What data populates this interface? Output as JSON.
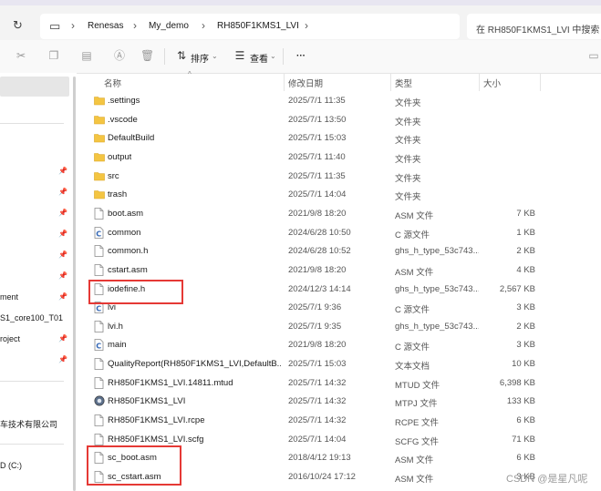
{
  "address_bar": {
    "breadcrumbs": [
      "Renesas",
      "My_demo",
      "RH850F1KMS1_LVI"
    ],
    "search_placeholder": "在 RH850F1KMS1_LVI 中搜索"
  },
  "toolbar": {
    "sort_label": "排序",
    "view_label": "查看",
    "more_label": "···"
  },
  "sidebar": {
    "items": [
      {
        "label": "ment"
      },
      {
        "label": "S1_core100_T01"
      },
      {
        "label": "roject"
      },
      {
        "label": "车技术有限公司"
      },
      {
        "label": "D (C:)"
      }
    ]
  },
  "columns": {
    "name": "名称",
    "date": "修改日期",
    "type": "类型",
    "size": "大小"
  },
  "files": [
    {
      "icon": "folder-icon",
      "name": ".settings",
      "date": "2025/7/1 11:35",
      "type": "文件夹",
      "size": ""
    },
    {
      "icon": "folder-icon",
      "name": ".vscode",
      "date": "2025/7/1 13:50",
      "type": "文件夹",
      "size": ""
    },
    {
      "icon": "folder-icon",
      "name": "DefaultBuild",
      "date": "2025/7/1 15:03",
      "type": "文件夹",
      "size": ""
    },
    {
      "icon": "folder-icon",
      "name": "output",
      "date": "2025/7/1 11:40",
      "type": "文件夹",
      "size": ""
    },
    {
      "icon": "folder-icon",
      "name": "src",
      "date": "2025/7/1 11:35",
      "type": "文件夹",
      "size": ""
    },
    {
      "icon": "folder-icon",
      "name": "trash",
      "date": "2025/7/1 14:04",
      "type": "文件夹",
      "size": ""
    },
    {
      "icon": "file-icon",
      "name": "boot.asm",
      "date": "2021/9/8 18:20",
      "type": "ASM 文件",
      "size": "7 KB"
    },
    {
      "icon": "c-file-icon",
      "name": "common",
      "date": "2024/6/28 10:50",
      "type": "C 源文件",
      "size": "1 KB"
    },
    {
      "icon": "file-icon",
      "name": "common.h",
      "date": "2024/6/28 10:52",
      "type": "ghs_h_type_53c743...",
      "size": "2 KB"
    },
    {
      "icon": "file-icon",
      "name": "cstart.asm",
      "date": "2021/9/8 18:20",
      "type": "ASM 文件",
      "size": "4 KB"
    },
    {
      "icon": "file-icon",
      "name": "iodefine.h",
      "date": "2024/12/3 14:14",
      "type": "ghs_h_type_53c743...",
      "size": "2,567 KB"
    },
    {
      "icon": "c-file-icon",
      "name": "lvi",
      "date": "2025/7/1 9:36",
      "type": "C 源文件",
      "size": "3 KB"
    },
    {
      "icon": "file-icon",
      "name": "lvi.h",
      "date": "2025/7/1 9:35",
      "type": "ghs_h_type_53c743...",
      "size": "2 KB"
    },
    {
      "icon": "c-file-icon",
      "name": "main",
      "date": "2021/9/8 18:20",
      "type": "C 源文件",
      "size": "3 KB"
    },
    {
      "icon": "file-icon",
      "name": "QualityReport(RH850F1KMS1_LVI,DefaultB...",
      "date": "2025/7/1 15:03",
      "type": "文本文档",
      "size": "10 KB"
    },
    {
      "icon": "file-icon",
      "name": "RH850F1KMS1_LVI.14811.mtud",
      "date": "2025/7/1 14:32",
      "type": "MTUD 文件",
      "size": "6,398 KB"
    },
    {
      "icon": "project-icon",
      "name": "RH850F1KMS1_LVI",
      "date": "2025/7/1 14:32",
      "type": "MTPJ 文件",
      "size": "133 KB"
    },
    {
      "icon": "file-icon",
      "name": "RH850F1KMS1_LVI.rcpe",
      "date": "2025/7/1 14:32",
      "type": "RCPE 文件",
      "size": "6 KB"
    },
    {
      "icon": "file-icon",
      "name": "RH850F1KMS1_LVI.scfg",
      "date": "2025/7/1 14:04",
      "type": "SCFG 文件",
      "size": "71 KB"
    },
    {
      "icon": "file-icon",
      "name": "sc_boot.asm",
      "date": "2018/4/12 19:13",
      "type": "ASM 文件",
      "size": "6 KB"
    },
    {
      "icon": "file-icon",
      "name": "sc_cstart.asm",
      "date": "2016/10/24 17:12",
      "type": "ASM 文件",
      "size": "3 KB"
    }
  ],
  "watermark": "CSDN @是星凡呢",
  "colors": {
    "folder": "#f4c542",
    "highlight": "#e53935",
    "c_icon": "#2f64b4"
  }
}
